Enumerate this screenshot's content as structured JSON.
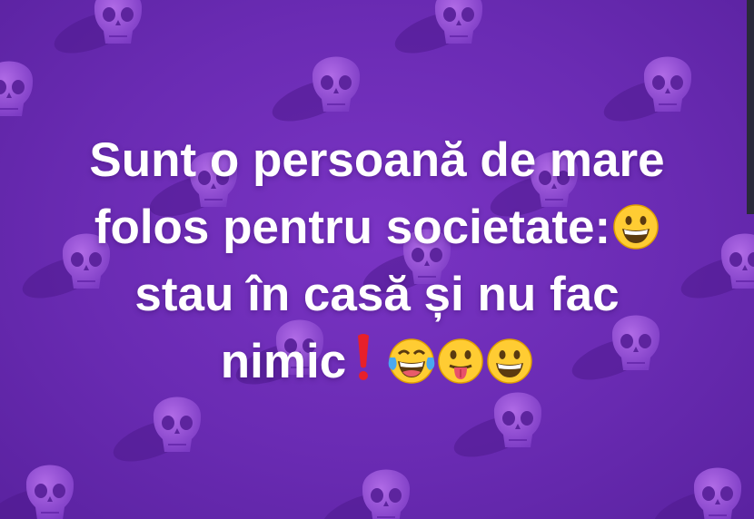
{
  "post": {
    "background_color": "#6a2bb0",
    "text_color": "#ffffff",
    "lines": [
      "Sunt o persoană de mare",
      "folos pentru societate:",
      "stau în casă și nu fac",
      "nimic"
    ],
    "emojis_line2": [
      "grinning-face-icon"
    ],
    "emojis_line4": [
      "red-exclamation-icon",
      "tears-of-joy-icon",
      "tongue-out-icon",
      "grinning-face-icon"
    ],
    "pattern_icon": "skull-icon"
  }
}
